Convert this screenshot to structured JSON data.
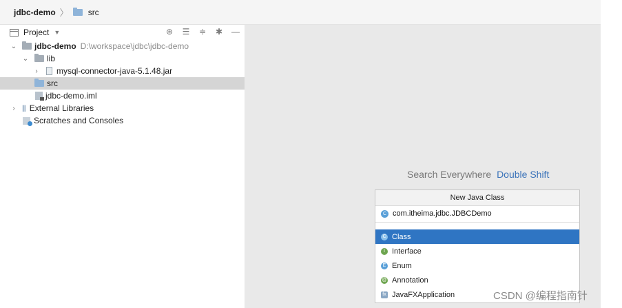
{
  "breadcrumb": {
    "project": "jdbc-demo",
    "folder": "src"
  },
  "panel": {
    "title": "Project",
    "tools": [
      "target-icon",
      "expand-all-icon",
      "collapse-all-icon",
      "gear-icon",
      "minimize-icon"
    ]
  },
  "tree": {
    "root": {
      "name": "jdbc-demo",
      "path": "D:\\workspace\\jdbc\\jdbc-demo"
    },
    "lib": "lib",
    "jar": "mysql-connector-java-5.1.48.jar",
    "src": "src",
    "iml": "jdbc-demo.iml",
    "external": "External Libraries",
    "scratches": "Scratches and Consoles"
  },
  "hint": {
    "text": "Search Everywhere",
    "shortcut": "Double Shift"
  },
  "dialog": {
    "title": "New Java Class",
    "name_value": "com.itheima.jdbc.JDBCDemo",
    "kinds": [
      {
        "label": "Class",
        "icon": "C",
        "selected": true
      },
      {
        "label": "Interface",
        "icon": "I",
        "selected": false
      },
      {
        "label": "Enum",
        "icon": "E",
        "selected": false
      },
      {
        "label": "Annotation",
        "icon": "@",
        "selected": false
      },
      {
        "label": "JavaFXApplication",
        "icon": "fx",
        "selected": false
      }
    ]
  },
  "watermark": "CSDN @编程指南针",
  "colors": {
    "selection": "#2f75c3",
    "folder": "#8fb4d9",
    "hint_key": "#3b73b9"
  }
}
